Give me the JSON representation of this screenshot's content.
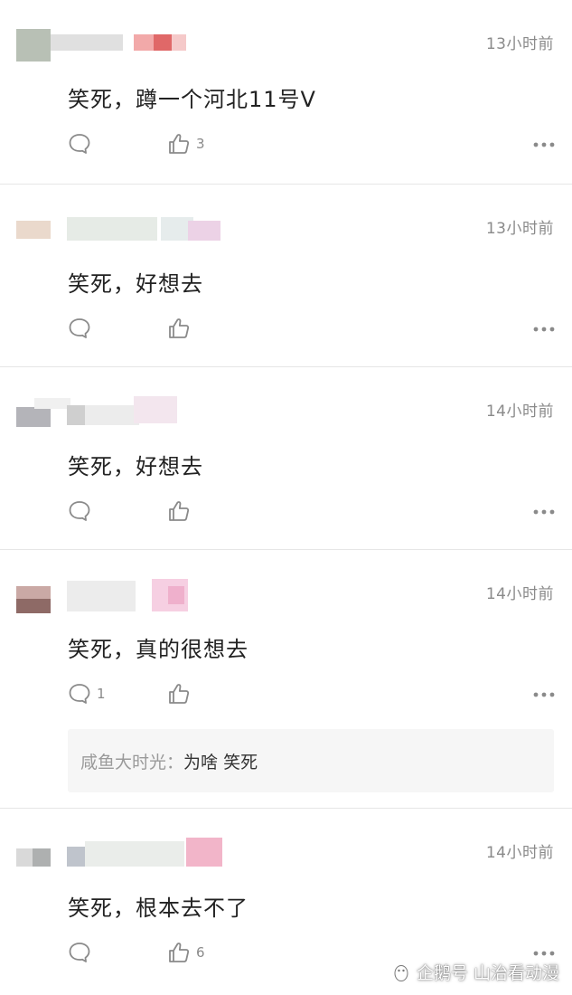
{
  "comments": [
    {
      "time": "13小时前",
      "text": "笑死，蹲一个河北11号V",
      "reply_count": "",
      "like_count": "3"
    },
    {
      "time": "13小时前",
      "text": "笑死，好想去",
      "reply_count": "",
      "like_count": ""
    },
    {
      "time": "14小时前",
      "text": "笑死，好想去",
      "reply_count": "",
      "like_count": ""
    },
    {
      "time": "14小时前",
      "text": "笑死，真的很想去",
      "reply_count": "1",
      "like_count": "",
      "sub_reply": {
        "user": "咸鱼大时光",
        "colon": "：",
        "text": "为啥 笑死"
      }
    },
    {
      "time": "14小时前",
      "text": "笑死，根本去不了",
      "reply_count": "",
      "like_count": "6"
    }
  ],
  "watermark": {
    "text": "企鹅号 山治看动漫"
  },
  "colors": {
    "text": "#222222",
    "muted": "#8a8a8a",
    "divider": "#e6e6e6",
    "reply_bg": "#f6f6f6"
  },
  "icons": [
    "comment-icon",
    "thumbs-up-icon",
    "more-icon",
    "penguin-icon"
  ]
}
